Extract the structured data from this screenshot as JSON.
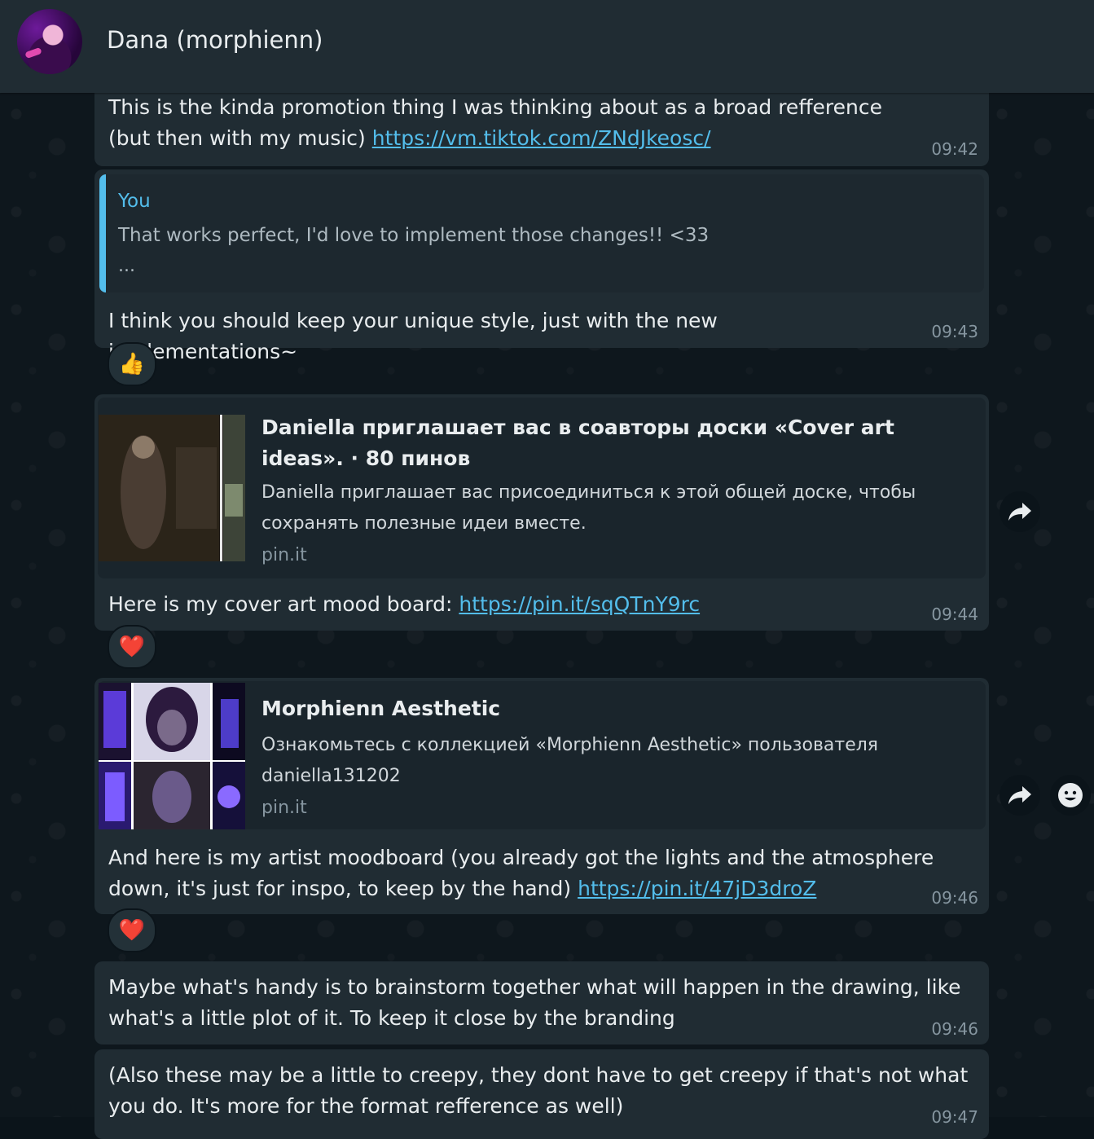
{
  "header": {
    "contact_name": "Dana (morphienn)"
  },
  "messages": [
    {
      "text": "This is the kinda promotion thing I was thinking about as a broad refference (but then with my music)",
      "link": "https://vm.tiktok.com/ZNdJkeosc/",
      "time": "09:42"
    },
    {
      "quote": {
        "author": "You",
        "text": "That works perfect, I'd love to implement those changes!! <33",
        "more": "..."
      },
      "text": "I think you should keep your unique style, just with the new implementations~",
      "time": "09:43",
      "reaction": "👍"
    },
    {
      "preview": {
        "title": "Daniella приглашает вас в соавторы доски «Cover art ideas». · 80 пинов",
        "description": "Daniella приглашает вас присоединиться к этой общей доске, чтобы сохранять полезные идеи вместе.",
        "domain": "pin.it"
      },
      "text": "Here is my cover art mood board:",
      "link": "https://pin.it/sqQTnY9rc",
      "time": "09:44",
      "reaction": "❤️"
    },
    {
      "preview": {
        "title": "Morphienn Aesthetic",
        "description": "Ознакомьтесь с коллекцией «Morphienn Aesthetic» пользователя daniella131202",
        "domain": "pin.it"
      },
      "text": "And here is my artist moodboard (you already got the lights and the atmosphere down, it's just for inspo, to keep by the hand)",
      "link": "https://pin.it/47jD3droZ",
      "time": "09:46",
      "reaction": "❤️"
    },
    {
      "text": "Maybe what's handy is to brainstorm together what will happen in the drawing, like what's a little plot of it. To keep it close by the branding",
      "time": "09:46"
    },
    {
      "text": "(Also these may be a little to creepy, they dont have to get creepy if that's not what you do. It's more for the format refference as well)",
      "time": "09:47"
    }
  ],
  "icons": {
    "forward": "forward-icon",
    "emoji": "emoji-icon"
  }
}
